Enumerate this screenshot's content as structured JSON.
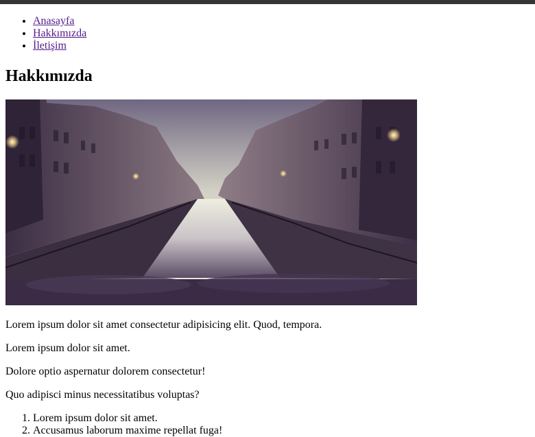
{
  "nav": {
    "items": [
      {
        "label": "Anasayfa"
      },
      {
        "label": "Hakkımızda"
      },
      {
        "label": "İletişim"
      }
    ]
  },
  "main": {
    "title": "Hakkımızda",
    "paragraphs": [
      "Lorem ipsum dolor sit amet consectetur adipisicing elit. Quod, tempora.",
      "Lorem ipsum dolor sit amet.",
      "Dolore optio aspernatur dolorem consectetur!",
      "Quo adipisci minus necessitatibus voluptas?"
    ],
    "list": [
      "Lorem ipsum dolor sit amet.",
      "Accusamus laborum maxime repellat fuga!"
    ]
  },
  "colors": {
    "top_bar": "#353535",
    "link_visited": "#551a8b"
  }
}
